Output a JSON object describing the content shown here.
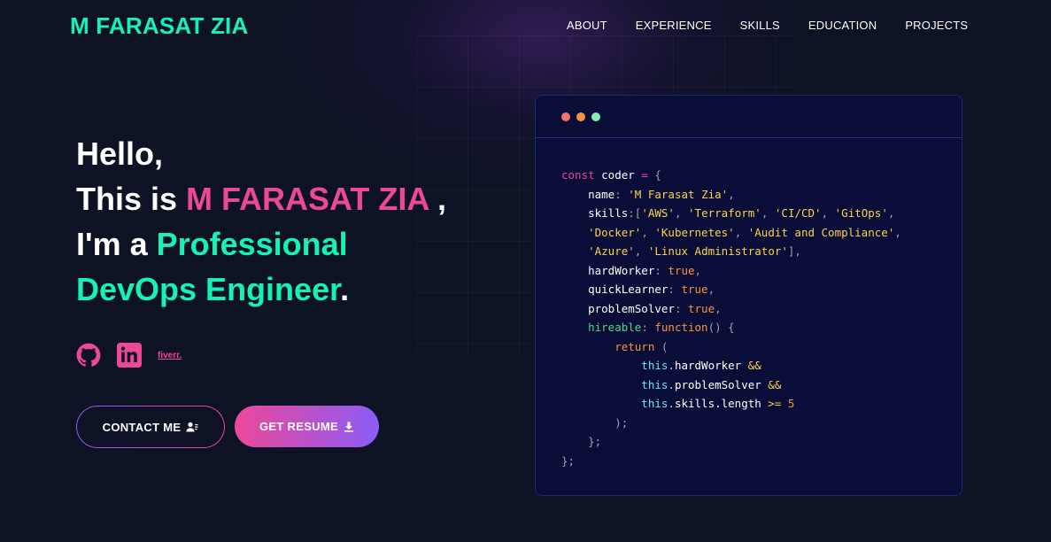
{
  "header": {
    "logo": "M FARASAT ZIA",
    "nav": [
      "ABOUT",
      "EXPERIENCE",
      "SKILLS",
      "EDUCATION",
      "PROJECTS"
    ]
  },
  "hero": {
    "line1": "Hello,",
    "line2_prefix": "This is ",
    "name": "M FARASAT ZIA",
    "line2_suffix": " ,",
    "line3_prefix": "I'm a ",
    "role1": "Professional",
    "role2": "DevOps Engineer",
    "period": "."
  },
  "socials": {
    "fiverr": "fiverr."
  },
  "buttons": {
    "contact": "CONTACT ME",
    "resume": "GET RESUME"
  },
  "code_card": {
    "dots": [
      "#f87171",
      "#fb923c",
      "#86efac"
    ],
    "lines": [
      [
        [
          "k",
          "const "
        ],
        [
          "v",
          "coder "
        ],
        [
          "k",
          "= "
        ],
        [
          "p",
          "{"
        ]
      ],
      [
        [
          "v",
          "    name"
        ],
        [
          "p",
          ": "
        ],
        [
          "str",
          "'M Farasat Zia'"
        ],
        [
          "p",
          ","
        ]
      ],
      [
        [
          "v",
          "    skills"
        ],
        [
          "p",
          ":["
        ],
        [
          "str",
          "'AWS'"
        ],
        [
          "p",
          ", "
        ],
        [
          "str",
          "'Terraform'"
        ],
        [
          "p",
          ", "
        ],
        [
          "str",
          "'CI/CD'"
        ],
        [
          "p",
          ", "
        ],
        [
          "str",
          "'GitOps'"
        ],
        [
          "p",
          ","
        ]
      ],
      [
        [
          "str",
          "    'Docker'"
        ],
        [
          "p",
          ", "
        ],
        [
          "str",
          "'Kubernetes'"
        ],
        [
          "p",
          ", "
        ],
        [
          "str",
          "'Audit and Compliance'"
        ],
        [
          "p",
          ","
        ]
      ],
      [
        [
          "str",
          "    'Azure'"
        ],
        [
          "p",
          ", "
        ],
        [
          "str",
          "'Linux Administrator'"
        ],
        [
          "p",
          "],"
        ]
      ],
      [
        [
          "v",
          "    hardWorker"
        ],
        [
          "p",
          ": "
        ],
        [
          "o",
          "true"
        ],
        [
          "p",
          ","
        ]
      ],
      [
        [
          "v",
          "    quickLearner"
        ],
        [
          "p",
          ": "
        ],
        [
          "o",
          "true"
        ],
        [
          "p",
          ","
        ]
      ],
      [
        [
          "v",
          "    problemSolver"
        ],
        [
          "p",
          ": "
        ],
        [
          "o",
          "true"
        ],
        [
          "p",
          ","
        ]
      ],
      [
        [
          "g",
          "    hireable"
        ],
        [
          "p",
          ": "
        ],
        [
          "o",
          "function"
        ],
        [
          "p",
          "() {"
        ]
      ],
      [
        [
          "o",
          "        return "
        ],
        [
          "p",
          "("
        ]
      ],
      [
        [
          "t",
          "            this."
        ],
        [
          "v",
          "hardWorker "
        ],
        [
          "str",
          "&&"
        ]
      ],
      [
        [
          "t",
          "            this."
        ],
        [
          "v",
          "problemSolver "
        ],
        [
          "str",
          "&&"
        ]
      ],
      [
        [
          "t",
          "            this."
        ],
        [
          "v",
          "skills.length "
        ],
        [
          "str",
          ">= "
        ],
        [
          "o",
          "5"
        ]
      ],
      [
        [
          "p",
          "        );"
        ]
      ],
      [
        [
          "p",
          "    };"
        ]
      ],
      [
        [
          "p",
          "};"
        ]
      ]
    ]
  }
}
